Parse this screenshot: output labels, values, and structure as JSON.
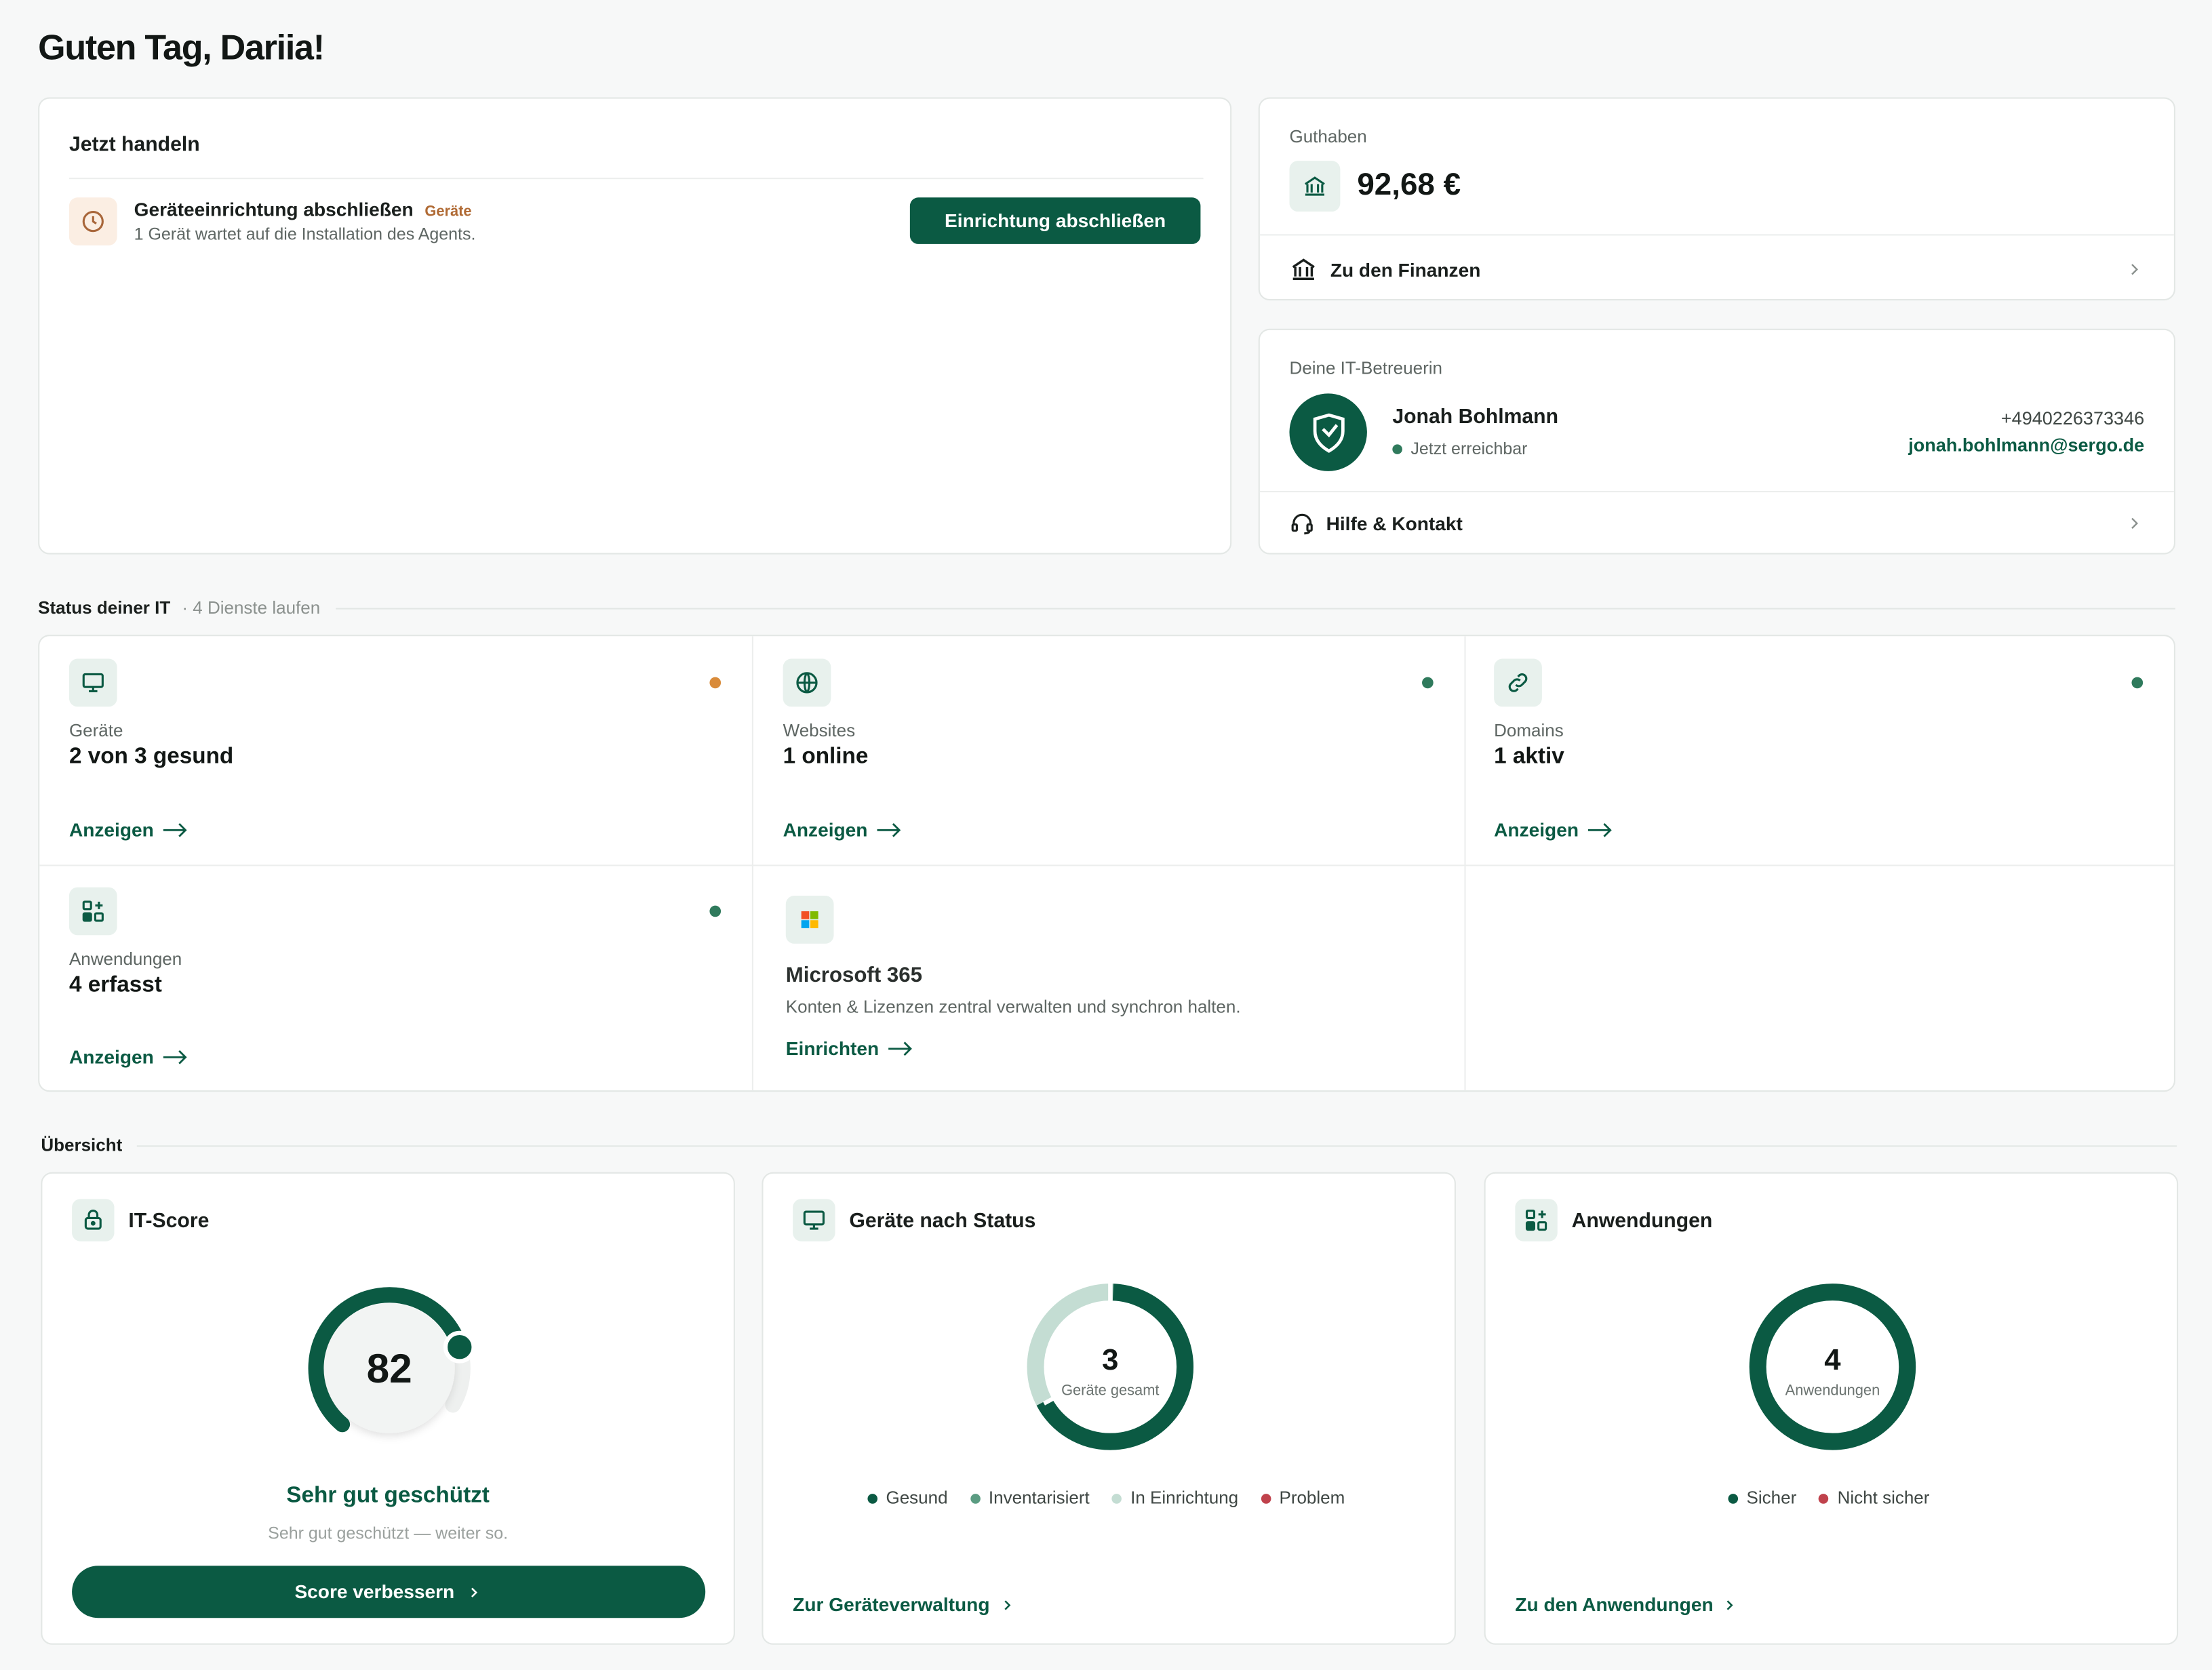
{
  "greeting": "Guten Tag, Dariia!",
  "action_card": {
    "title": "Jetzt handeln",
    "item_title": "Geräteeinrichtung abschließen",
    "item_tag": "Geräte",
    "item_desc": "1 Gerät wartet auf die Installation des Agents.",
    "button": "Einrichtung abschließen"
  },
  "balance": {
    "label": "Guthaben",
    "amount": "92,68 €",
    "link": "Zu den Finanzen"
  },
  "contact": {
    "label": "Deine IT-Betreuerin",
    "name": "Jonah Bohlmann",
    "status": "Jetzt erreichbar",
    "phone": "+4940226373346",
    "email": "jonah.bohlmann@sergo.de",
    "link": "Hilfe & Kontakt"
  },
  "status_section": {
    "title": "Status deiner IT",
    "subtitle": "· 4 Dienste laufen",
    "tiles": [
      {
        "label": "Geräte",
        "value": "2 von 3 gesund",
        "link": "Anzeigen",
        "icon": "monitor-icon",
        "dot": "#d98b3a"
      },
      {
        "label": "Websites",
        "value": "1 online",
        "link": "Anzeigen",
        "icon": "globe-icon",
        "dot": "#2f7a5c"
      },
      {
        "label": "Domains",
        "value": "1 aktiv",
        "link": "Anzeigen",
        "icon": "link-icon",
        "dot": "#2f7a5c"
      },
      {
        "label": "Anwendungen",
        "value": "4 erfasst",
        "link": "Anzeigen",
        "icon": "apps-icon",
        "dot": "#2f7a5c"
      }
    ],
    "ms365": {
      "title": "Microsoft 365",
      "desc": "Konten & Lizenzen zentral verwalten und synchron halten.",
      "link": "Einrichten"
    }
  },
  "overview": {
    "title": "Übersicht",
    "score": {
      "title": "IT-Score",
      "value": "82",
      "fraction": 0.82,
      "verdict": "Sehr gut geschützt",
      "note": "Sehr gut geschützt — weiter so.",
      "button": "Score verbessern"
    },
    "devices": {
      "title": "Geräte nach Status",
      "total": "3",
      "total_label": "Geräte gesamt",
      "legend": [
        {
          "label": "Gesund",
          "color": "#0b5a43"
        },
        {
          "label": "Inventarisiert",
          "color": "#5b9c82"
        },
        {
          "label": "In Einrichtung",
          "color": "#c4ddd3"
        },
        {
          "label": "Problem",
          "color": "#c0424c"
        }
      ],
      "link": "Zur Geräteverwaltung"
    },
    "apps": {
      "title": "Anwendungen",
      "total": "4",
      "total_label": "Anwendungen",
      "legend": [
        {
          "label": "Sicher",
          "color": "#0b5a43"
        },
        {
          "label": "Nicht sicher",
          "color": "#c0424c"
        }
      ],
      "link": "Zu den Anwendungen"
    }
  },
  "colors": {
    "brand": "#0b5a43",
    "warning": "#d98b3a",
    "danger": "#c0424c"
  }
}
